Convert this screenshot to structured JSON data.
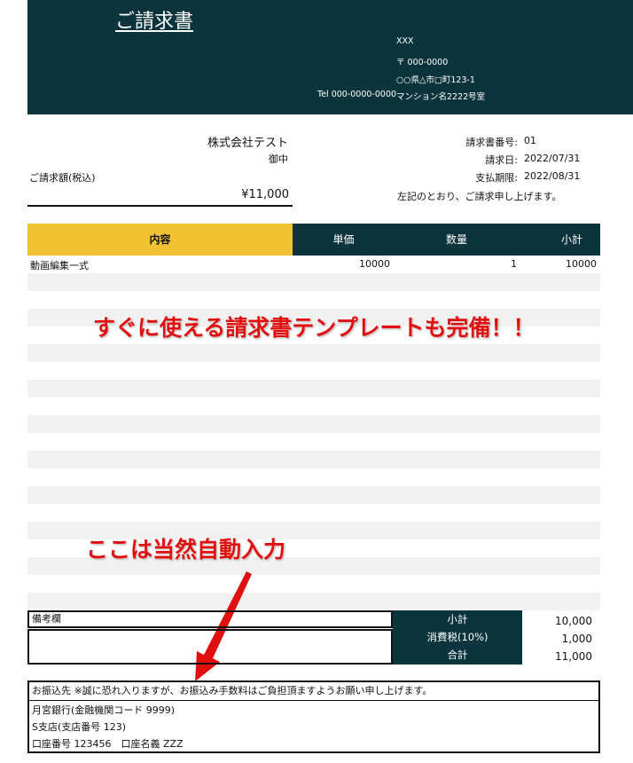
{
  "header": {
    "title": "ご請求書",
    "company": "XXX",
    "postal": "〒 000-0000",
    "address1": "○○県△市□町123-1",
    "tel": "Tel 000-0000-0000",
    "address2": "マンション名2222号室"
  },
  "client": {
    "name": "株式会社テスト",
    "honorific": "御中",
    "amount_label": "ご請求額(税込)",
    "amount": "¥11,000"
  },
  "meta": {
    "invoice_no_label": "請求書番号:",
    "invoice_no": "01",
    "date_label": "請求日:",
    "date": "2022/07/31",
    "due_label": "支払期限:",
    "due": "2022/08/31",
    "message": "左記のとおり、ご請求申し上げます。"
  },
  "table": {
    "headers": [
      "内容",
      "単価",
      "数量",
      "小計"
    ],
    "rows": [
      {
        "item": "動画編集一式",
        "price": "10000",
        "qty": "1",
        "subtotal": "10000"
      }
    ]
  },
  "notes": {
    "label": "備考欄"
  },
  "summary": {
    "subtotal_label": "小計",
    "subtotal": "10,000",
    "tax_label": "消費税(10%)",
    "tax": "1,000",
    "total_label": "合計",
    "total": "11,000"
  },
  "bank": {
    "header": "お振込先 ※誠に恐れ入りますが、お振込み手数料はご負担頂ますようお願い申し上げます。",
    "line1": "月宮銀行(金融機関コード 9999)",
    "line2": "S支店(支店番号 123)",
    "line3": "口座番号 123456　口座名義 ZZZ"
  },
  "annotations": {
    "top": "すぐに使える請求書テンプレートも完備！！",
    "bottom": "ここは当然自動入力"
  },
  "colors": {
    "header_bg": "#0c343d",
    "accent": "#f1c232",
    "annotation": "#e01010"
  }
}
